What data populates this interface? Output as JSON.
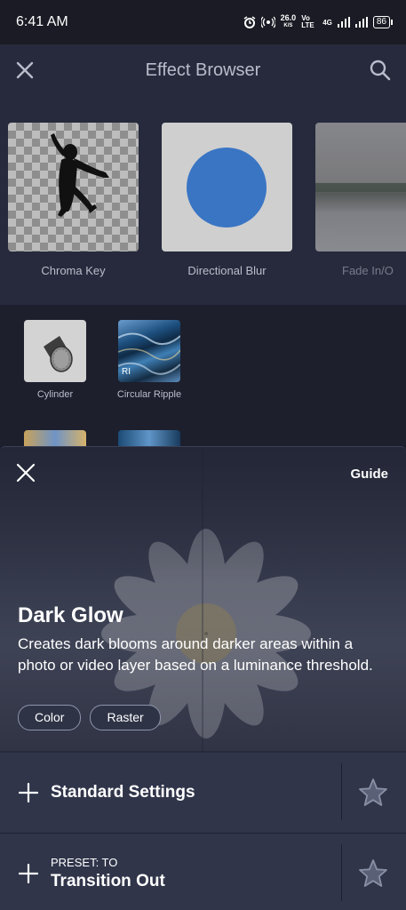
{
  "status": {
    "time": "6:41 AM",
    "speed_value": "26.0",
    "speed_unit": "K/S",
    "net1": "Vo LTE",
    "net2": "4G",
    "battery": "86"
  },
  "header": {
    "title": "Effect Browser",
    "close_icon": "close-icon",
    "search_icon": "search-icon"
  },
  "featured": [
    {
      "label": "Chroma Key"
    },
    {
      "label": "Directional Blur"
    },
    {
      "label": "Fade In/O"
    }
  ],
  "effects_grid": [
    {
      "label": "Cylinder"
    },
    {
      "label": "Circular Ripple",
      "badge": "RI"
    }
  ],
  "sheet": {
    "guide_label": "Guide",
    "effect_name": "Dark Glow",
    "description": "Creates dark blooms around darker areas within a photo or video layer based on a luminance threshold.",
    "tags": [
      "Color",
      "Raster"
    ]
  },
  "rows": [
    {
      "title": "Standard Settings"
    },
    {
      "subtitle": "PRESET:  TO",
      "title": "Transition Out"
    }
  ],
  "colors": {
    "background": "#1d1f2d",
    "panel": "#262a3c",
    "row": "#30354a",
    "accent_blue": "#3a75c4"
  }
}
